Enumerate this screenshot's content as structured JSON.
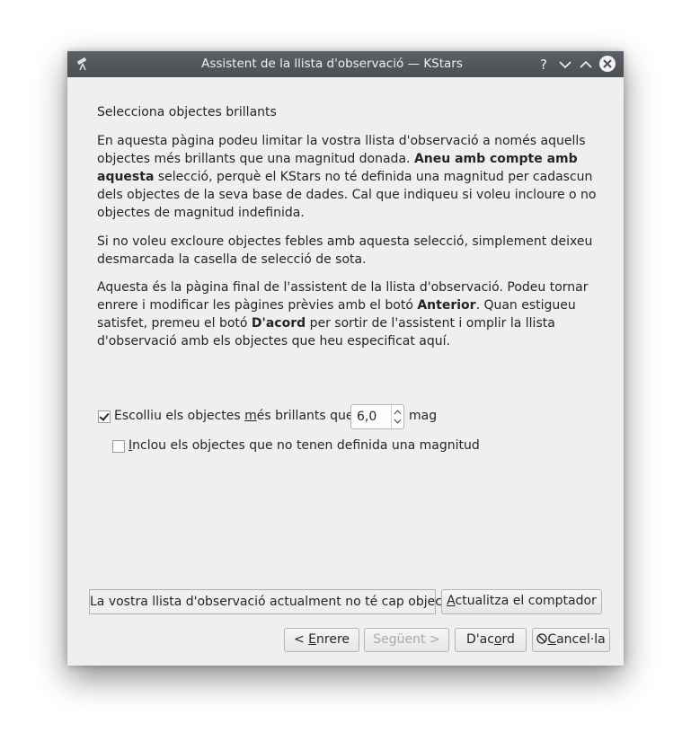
{
  "window": {
    "title": "Assistent de la llista d'observació — KStars"
  },
  "titlebar": {
    "icons": [
      "telescope-icon",
      "help-icon",
      "minimize-icon",
      "maximize-icon",
      "close-icon"
    ],
    "help_glyph": "?"
  },
  "page": {
    "heading": "Selecciona objectes brillants",
    "p1_a": "En aquesta pàgina podeu limitar la vostra llista d'observació a només aquells objectes més brillants que una magnitud donada. ",
    "p1_bold": "Aneu amb compte amb aquesta",
    "p1_b": " selecció, perquè el KStars no té definida una magnitud per cadascun dels objectes de la seva base de dades. Cal que indiqueu si voleu incloure o no objectes de magnitud indefinida.",
    "p2": "Si no voleu excloure objectes febles amb aquesta selecció, simplement deixeu desmarcada la casella de selecció de sota.",
    "p3_a": "Aquesta és la pàgina final de l'assistent de la llista d'observació. Podeu tornar enrere i modificar les pàgines prèvies amb el botó ",
    "p3_bold1": "Anterior",
    "p3_b": ". Quan estigueu satisfet, premeu el botó ",
    "p3_bold2": "D'acord",
    "p3_c": " per sortir de l'assistent i omplir la llista d'observació amb els objectes que heu especificat aquí."
  },
  "options": {
    "brightest_checked": true,
    "brightest_label_pre": "Escolliu els objectes ",
    "brightest_label_u": "m",
    "brightest_label_post": "és brillants que:",
    "mag_value": "6,0",
    "mag_unit": "mag",
    "include_undefined_checked": false,
    "include_u": "I",
    "include_rest": "nclou els objectes que no tenen definida una magnitud"
  },
  "status": {
    "count_text": "La vostra llista d'observació actualment no té cap objecte.",
    "update_u": "A",
    "update_rest": "ctualitza el comptador"
  },
  "buttons": {
    "back_pre": "< ",
    "back_u": "E",
    "back_post": "nrere",
    "next": "Següent >",
    "ok_pre": "D'ac",
    "ok_u": "o",
    "ok_post": "rd",
    "cancel_u": "C",
    "cancel_post": "ancel·la"
  }
}
